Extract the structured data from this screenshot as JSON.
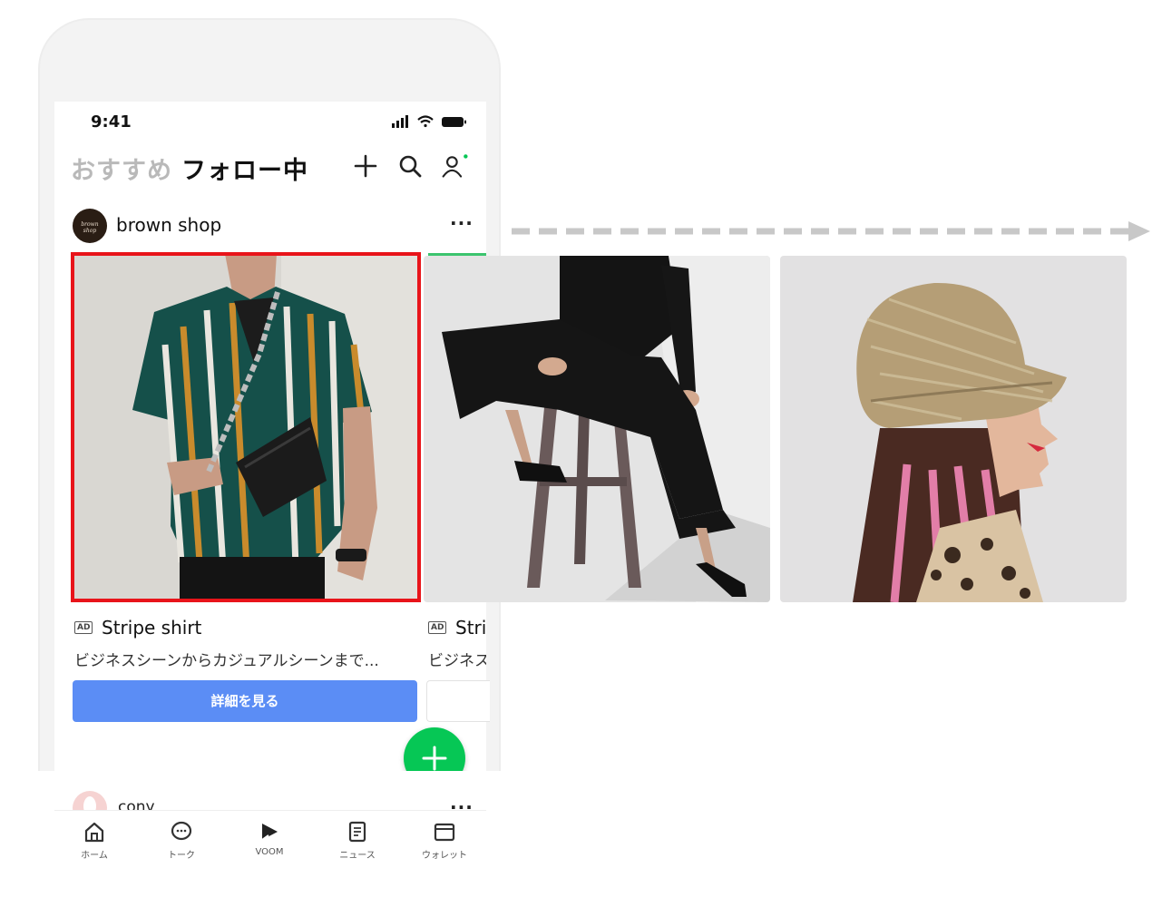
{
  "status_bar": {
    "time": "9:41"
  },
  "header": {
    "tab_recommended": "おすすめ",
    "tab_following": "フォロー中",
    "icons": [
      "plus-icon",
      "search-icon",
      "profile-icon"
    ]
  },
  "post": {
    "shop_name": "brown shop",
    "avatar_text": "brown shop",
    "more": "···"
  },
  "cards": [
    {
      "ad": "AD",
      "title": "Stripe shirt",
      "desc": "ビジネスシーンからカジュアルシーンまで...",
      "button": "詳細を見る"
    },
    {
      "ad": "AD",
      "title": "Stri",
      "desc": "ビジネス"
    }
  ],
  "next_post": {
    "name": "cony",
    "more": "···"
  },
  "bottom_nav": [
    {
      "label": "ホーム",
      "icon": "home-icon"
    },
    {
      "label": "トーク",
      "icon": "chat-icon"
    },
    {
      "label": "VOOM",
      "icon": "voom-icon"
    },
    {
      "label": "ニュース",
      "icon": "news-icon"
    },
    {
      "label": "ウォレット",
      "icon": "wallet-icon"
    }
  ],
  "colors": {
    "highlight": "#e8141a",
    "button": "#5b8df5",
    "fab": "#06c755",
    "accent": "#3cc46e"
  }
}
